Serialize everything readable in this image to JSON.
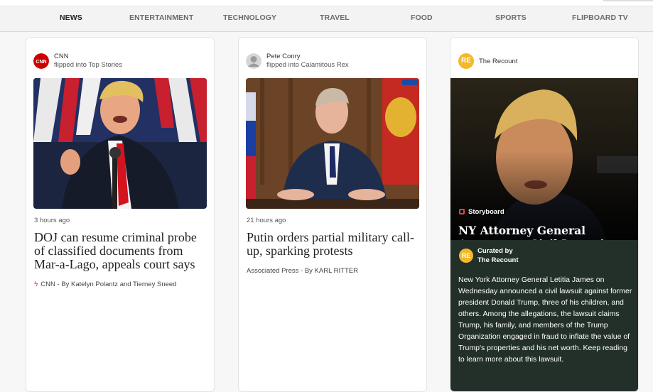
{
  "nav": {
    "tabs": [
      "NEWS",
      "ENTERTAINMENT",
      "TECHNOLOGY",
      "TRAVEL",
      "FOOD",
      "SPORTS",
      "FLIPBOARD TV"
    ],
    "active": "NEWS"
  },
  "cards": [
    {
      "author": "CNN",
      "flipped": "flipped into Top Stories",
      "avatar_text": "CNN",
      "time": "3 hours ago",
      "headline": "DOJ can resume criminal probe of classified documents from Mar-a-Lago, appeals court says",
      "source": "CNN - By Katelyn Polantz and Tierney Sneed"
    },
    {
      "author": "Pete Conry",
      "flipped": "flipped into Calamitous Rex",
      "time": "21 hours ago",
      "headline": "Putin orders partial military call-up, sparking protests",
      "source": "Associated Press - By KARL RITTER"
    }
  ],
  "featured": {
    "publisher": "The Recount",
    "logo_text": "RE",
    "tag": "Storyboard",
    "title": "NY Attorney General Announces Civil Lawsuit Against Trump",
    "curated_label": "Curated by",
    "curated_by": "The Recount",
    "body": "New York Attorney General Letitia James on Wednesday announced a civil lawsuit against former president Donald Trump, three of his children, and others. Among the allegations, the lawsuit claims Trump, his family, and members of the Trump Organization engaged in fraud to inflate the value of Trump's properties and his net worth. Keep reading to learn more about this lawsuit."
  },
  "colors": {
    "accent_red": "#e33333",
    "recount_yellow": "#f3b82b",
    "panel_dark": "#23302a"
  }
}
